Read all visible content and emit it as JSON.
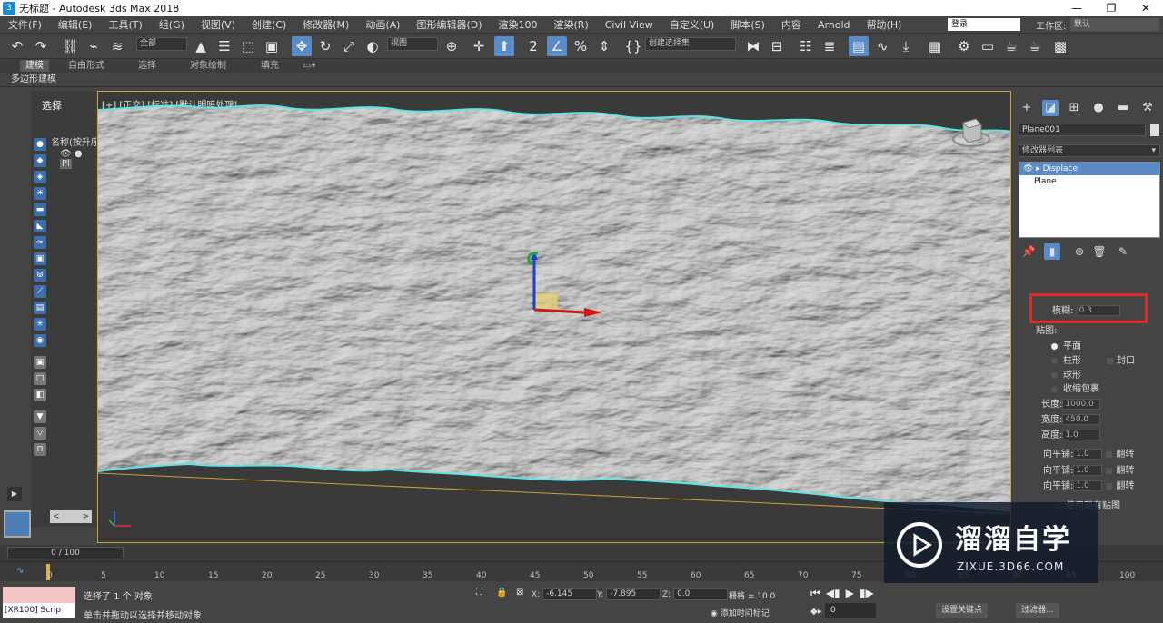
{
  "window": {
    "title": "无标题 - Autodesk 3ds Max 2018",
    "app_icon": "3",
    "minimize": "—",
    "maximize": "❐",
    "close": "✕"
  },
  "menu": {
    "items": [
      "文件(F)",
      "编辑(E)",
      "工具(T)",
      "组(G)",
      "视图(V)",
      "创建(C)",
      "修改器(M)",
      "动画(A)",
      "图形编辑器(D)",
      "渲染100",
      "渲染(R)",
      "Civil View",
      "自定义(U)",
      "脚本(S)",
      "内容",
      "Arnold",
      "帮助(H)"
    ],
    "login": "登录",
    "workspace_label": "工作区:",
    "workspace_value": "默认"
  },
  "toolbar": {
    "filter_dropdown": "全部",
    "refcoord_dropdown": "视图",
    "selection_set": "创建选择集"
  },
  "ribbon": {
    "tabs": [
      "建模",
      "自由形式",
      "选择",
      "对象绘制",
      "填充"
    ],
    "sub": "多边形建模"
  },
  "scene_explorer": {
    "header": "选择",
    "column": "名称(按升序)",
    "object": "Pl"
  },
  "viewport": {
    "label": "[+] [正交] [标准] [默认明暗处理]"
  },
  "command_panel": {
    "object_name": "Plane001",
    "modifier_list": "修改器列表",
    "stack": [
      "Displace",
      "Plane"
    ],
    "blur_label": "模糊:",
    "blur_value": "0.3",
    "map_label": "贴图:",
    "mapping": [
      "平面",
      "柱形",
      "球形",
      "收缩包裹"
    ],
    "cap_label": "封口",
    "length_label": "长度:",
    "length_value": "1000.0",
    "width_label": "宽度:",
    "width_value": "450.0",
    "height_label": "高度:",
    "height_value": "1.0",
    "tile_rows": [
      {
        "label": "向平铺:",
        "value": "1.0",
        "flip": "翻转"
      },
      {
        "label": "向平铺:",
        "value": "1.0",
        "flip": "翻转"
      },
      {
        "label": "向平铺:",
        "value": "1.0",
        "flip": "翻转"
      }
    ],
    "use_existing": "使用现有贴图"
  },
  "timeline": {
    "frame_display": "0 / 100",
    "ticks": [
      "0",
      "5",
      "10",
      "15",
      "20",
      "25",
      "30",
      "35",
      "40",
      "45",
      "50",
      "55",
      "60",
      "65",
      "70",
      "75",
      "80",
      "85",
      "90",
      "95",
      "100"
    ]
  },
  "status": {
    "maxscript": "[XR100] Scrip",
    "selected": "选择了 1 个 对象",
    "prompt": "单击并拖动以选择并移动对象",
    "x_label": "X:",
    "x_value": "-6.145",
    "y_label": "Y:",
    "y_value": "-7.895",
    "z_label": "Z:",
    "z_value": "0.0",
    "grid": "栅格 = 10.0",
    "add_time_tag": "添加时间标记",
    "frame_field": "0",
    "set_key": "设置关键点",
    "filters": "过滤器..."
  },
  "watermark": {
    "title": "溜溜自学",
    "url": "ZIXUE.3D66.COM"
  },
  "colors": {
    "accent": "#5b8bc7",
    "highlight_box": "#e02a2a",
    "viewport_border": "#c9a23a",
    "mesh": "#c8c8c8"
  }
}
